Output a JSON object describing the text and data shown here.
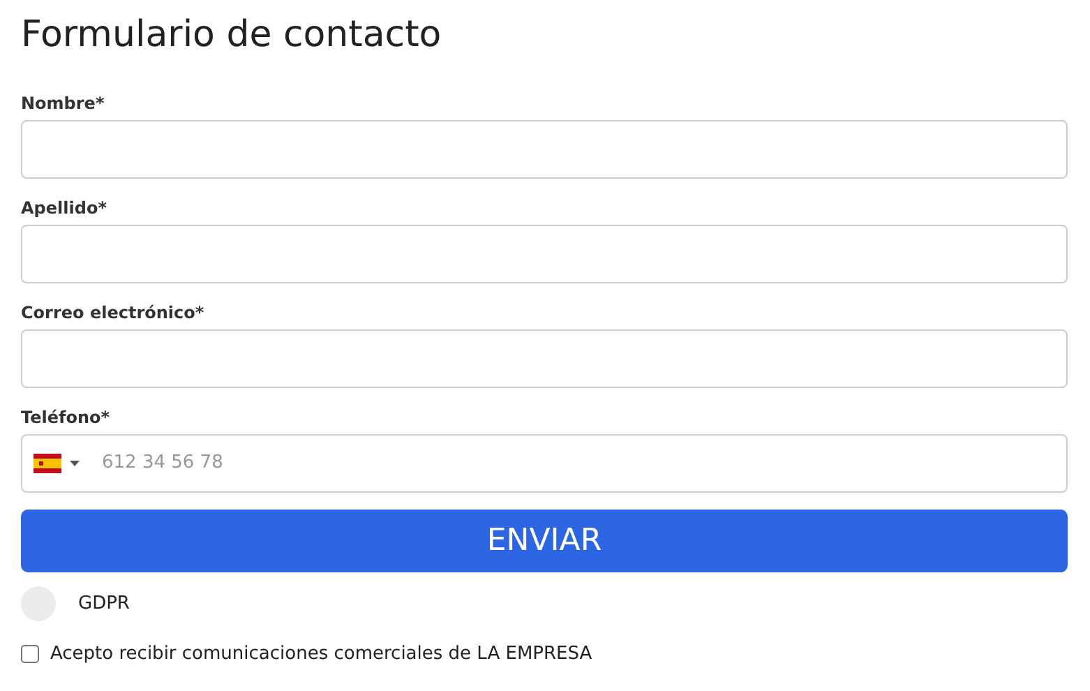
{
  "title": "Formulario de contacto",
  "fields": [
    {
      "label": "Nombre*",
      "kind": "text"
    },
    {
      "label": "Apellido*",
      "kind": "text"
    },
    {
      "label": "Correo electrónico*",
      "kind": "text"
    },
    {
      "label": "Teléfono*",
      "kind": "phone",
      "placeholder": "612 34 56 78"
    }
  ],
  "submit": "ENVIAR",
  "gdpr": {
    "label": "GDPR"
  },
  "consent": {
    "label": "Acepto recibir comunicaciones comerciales de LA EMPRESA",
    "checked": false
  }
}
